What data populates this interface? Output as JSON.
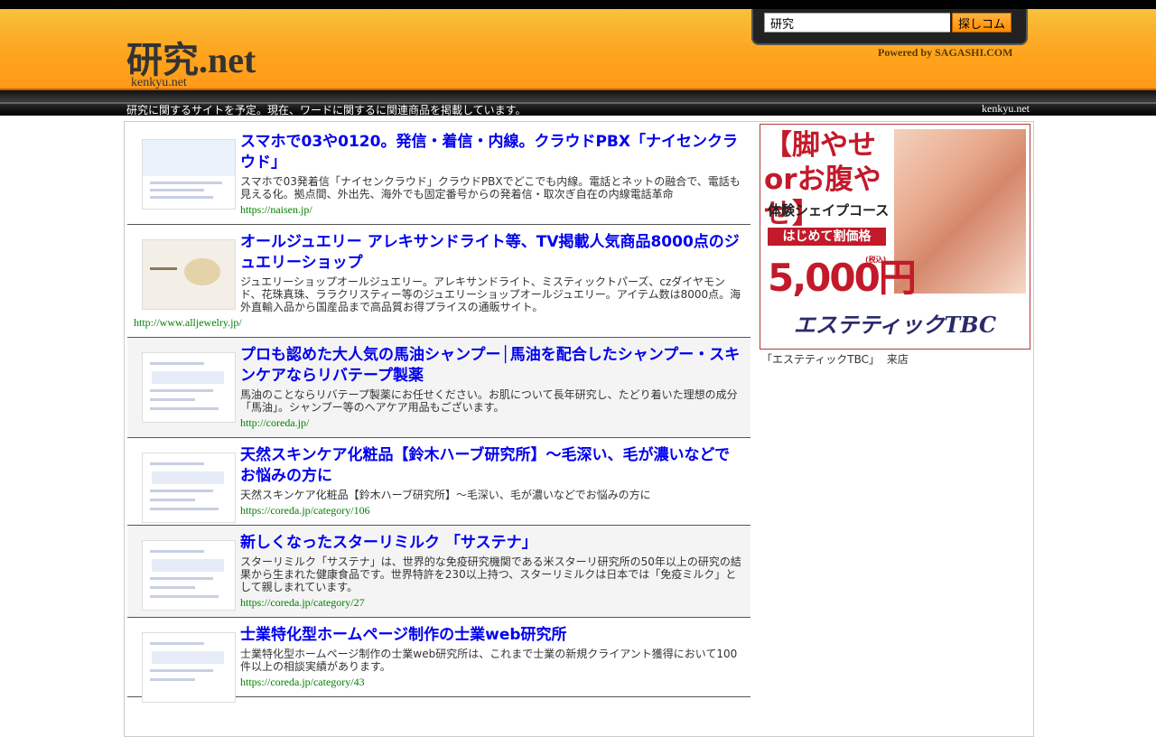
{
  "header": {
    "site_title": "研究.net",
    "site_domain": "kenkyu.net",
    "search_value": "研究",
    "search_button": "探しコム",
    "powered_by": "Powered by SAGASHI.COM"
  },
  "subbar": {
    "description": "研究に関するサイトを予定。現在、ワードに関するに関連商品を掲載しています。",
    "domain": "kenkyu.net"
  },
  "results": [
    {
      "title": "スマホで03や0120。発信・着信・内線。クラウドPBX「ナイセンクラウド」",
      "description": "スマホで03発着信「ナイセンクラウド」クラウドPBXでどこでも内線。電話とネットの融合で、電話も見える化。拠点間、外出先、海外でも固定番号からの発着信・取次ぎ自在の内線電話革命",
      "url": "https://naisen.jp/"
    },
    {
      "title": "オールジュエリー アレキサンドライト等、TV掲載人気商品8000点のジュエリーショップ",
      "description": "ジュエリーショップオールジュエリー。アレキサンドライト、ミスティックトパーズ、czダイヤモンド、花珠真珠、ララクリスティー等のジュエリーショップオールジュエリー。アイテム数は8000点。海外直輸入品から国産品まで高品質お得プライスの通販サイト。",
      "url": "http://www.alljewelry.jp/"
    },
    {
      "title": "プロも認めた大人気の馬油シャンプー│馬油を配合したシャンプー・スキンケアならリバテープ製薬",
      "description": "馬油のことならリバテープ製薬にお任せください。お肌について長年研究し、たどり着いた理想の成分「馬油」。シャンプー等のヘアケア用品もございます。",
      "url": "http://coreda.jp/"
    },
    {
      "title": "天然スキンケア化粧品【鈴木ハーブ研究所】〜毛深い、毛が濃いなどでお悩みの方に",
      "description": "天然スキンケア化粧品【鈴木ハーブ研究所】〜毛深い、毛が濃いなどでお悩みの方に",
      "url": "https://coreda.jp/category/106"
    },
    {
      "title": "新しくなったスターリミルク 「サステナ」",
      "description": "スターリミルク「サステナ」は、世界的な免疫研究機関である米スターリ研究所の50年以上の研究の結果から生まれた健康食品です。世界特許を230以上持つ、スターリミルクは日本では「免疫ミルク」として親しまれています。",
      "url": "https://coreda.jp/category/27"
    },
    {
      "title": "士業特化型ホームページ制作の士業web研究所",
      "description": "士業特化型ホームページ制作の士業web研究所は、これまで士業の新規クライアント獲得において100件以上の相談実績があります。",
      "url": "https://coreda.jp/category/43"
    }
  ],
  "ad": {
    "headline": "【脚やせorお腹やせ】",
    "course": "体験シェイプコース",
    "price_label": "はじめて割価格",
    "price": "5,000円",
    "tax": "(税込)",
    "brand": "エステティックTBC",
    "caption": "「エステティックTBC」 来店"
  },
  "colors": {
    "header_orange": "#ffa31c",
    "link_blue": "#0000ee",
    "url_green": "#008000",
    "ad_red": "#c21a2a"
  }
}
